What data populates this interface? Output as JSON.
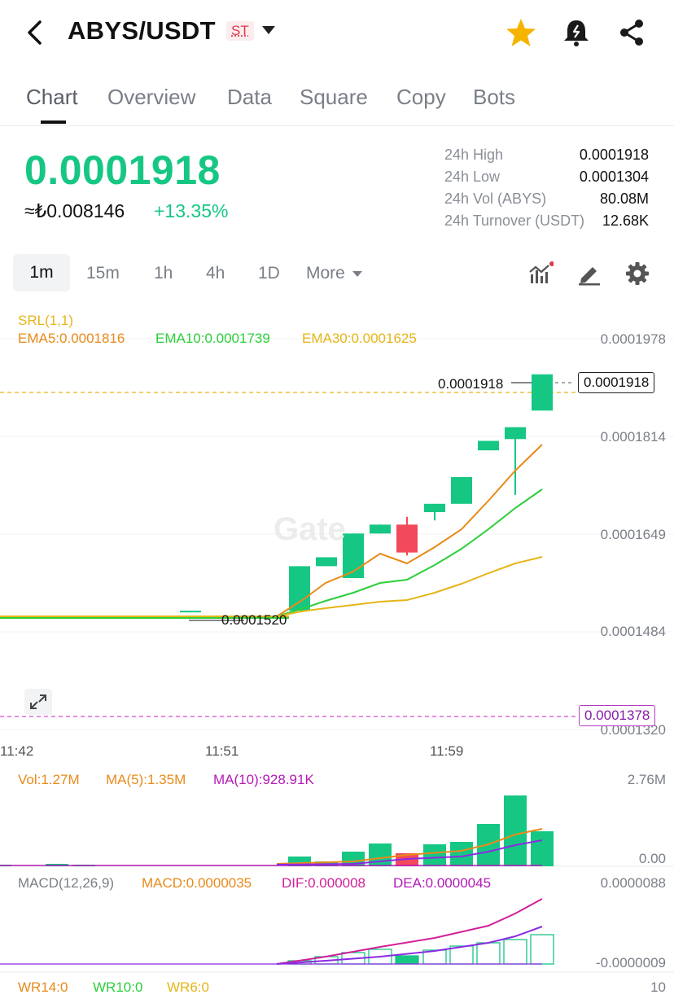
{
  "header": {
    "pair": "ABYS/USDT",
    "badge": "ST",
    "icons": [
      "back-arrow-icon",
      "star-icon",
      "bell-alert-icon",
      "share-icon"
    ],
    "star_color": "#f5b400"
  },
  "tabs": [
    "Chart",
    "Overview",
    "Data",
    "Square",
    "Copy",
    "Bots"
  ],
  "active_tab": "Chart",
  "ticker": {
    "last_price": "0.0001918",
    "fiat_price": "≈₺0.008146",
    "change": "+13.35%",
    "stats": [
      {
        "label": "24h High",
        "value": "0.0001918"
      },
      {
        "label": "24h Low",
        "value": "0.0001304"
      },
      {
        "label": "24h Vol (ABYS)",
        "value": "80.08M"
      },
      {
        "label": "24h Turnover (USDT)",
        "value": "12.68K"
      }
    ]
  },
  "intervals": [
    "1m",
    "15m",
    "1h",
    "4h",
    "1D",
    "More"
  ],
  "active_interval": "1m",
  "toolbar_icons": [
    "indicators-icon",
    "draw-pen-icon",
    "settings-gear-icon"
  ],
  "indicators": {
    "srl": "SRL(1,1)",
    "ema5": "EMA5:0.0001816",
    "ema10": "EMA10:0.0001739",
    "ema30": "EMA30:0.0001625"
  },
  "price_axis": [
    "0.0001978",
    "0.0001814",
    "0.0001649",
    "0.0001484",
    "0.0001320"
  ],
  "last_price_tag": "0.0001918",
  "high_marker": "0.0001918",
  "low_marker": "0.0001520",
  "alert_line_tag": "0.0001378",
  "watermark": "Gate",
  "time_axis": [
    "11:42",
    "11:51",
    "11:59"
  ],
  "volume": {
    "vol": "Vol:1.27M",
    "ma5": "MA(5):1.35M",
    "ma10": "MA(10):928.91K",
    "axis_top": "2.76M",
    "axis_bottom": "0.00"
  },
  "macd": {
    "title": "MACD(12,26,9)",
    "macd": "MACD:0.0000035",
    "dif": "DIF:0.000008",
    "dea": "DEA:0.0000045",
    "axis_top": "0.0000088",
    "axis_bottom": "-0.0000009"
  },
  "wr": {
    "wr14": "WR14:0",
    "wr10": "WR10:0",
    "wr6": "WR6:0",
    "axis": "10"
  },
  "colors": {
    "up": "#16c784",
    "down": "#f2495c",
    "ema5": "#e88a1a",
    "ema10": "#2bcf3a",
    "ema30": "#e6b517",
    "dif": "#d21f9a",
    "dea": "#8a2be2"
  },
  "chart_data": {
    "type": "candlestick",
    "interval": "1m",
    "time_labels": [
      "11:42",
      "11:51",
      "11:59"
    ],
    "candles": [
      {
        "o": 0.000152,
        "h": 0.000152,
        "l": 0.000152,
        "c": 0.000152
      },
      {
        "o": 0.000152,
        "h": 0.0001595,
        "l": 0.000152,
        "c": 0.0001595
      },
      {
        "o": 0.0001595,
        "h": 0.000161,
        "l": 0.0001595,
        "c": 0.000161
      },
      {
        "o": 0.0001575,
        "h": 0.000165,
        "l": 0.0001575,
        "c": 0.000165
      },
      {
        "o": 0.000165,
        "h": 0.0001665,
        "l": 0.000165,
        "c": 0.0001665
      },
      {
        "o": 0.0001665,
        "h": 0.0001678,
        "l": 0.0001613,
        "c": 0.0001618
      },
      {
        "o": 0.0001686,
        "h": 0.00017,
        "l": 0.0001672,
        "c": 0.00017
      },
      {
        "o": 0.00017,
        "h": 0.0001745,
        "l": 0.00017,
        "c": 0.0001745
      },
      {
        "o": 0.000179,
        "h": 0.0001806,
        "l": 0.000179,
        "c": 0.0001806
      },
      {
        "o": 0.0001809,
        "h": 0.0001829,
        "l": 0.0001715,
        "c": 0.0001829
      },
      {
        "o": 0.0001857,
        "h": 0.0001918,
        "l": 0.0001857,
        "c": 0.0001918
      }
    ],
    "ylim": [
      0.000132,
      0.0001978
    ]
  }
}
